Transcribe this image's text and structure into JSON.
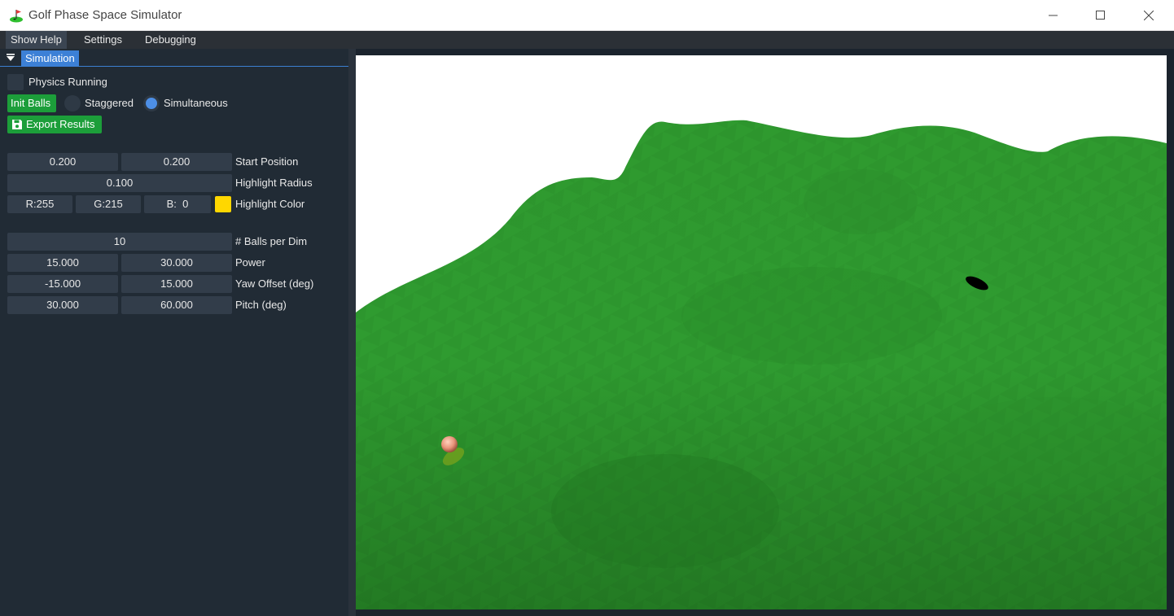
{
  "window": {
    "title": "Golf Phase Space Simulator",
    "icon": "golf-flag-icon",
    "controls": [
      "minimize-icon",
      "maximize-icon",
      "close-icon"
    ]
  },
  "menu": {
    "show_help": "Show Help",
    "settings": "Settings",
    "debugging": "Debugging"
  },
  "panel": {
    "tab": "Simulation",
    "physics_running": {
      "label": "Physics Running",
      "checked": false
    },
    "init_balls": "Init Balls",
    "mode": {
      "staggered": "Staggered",
      "simultaneous": "Simultaneous",
      "selected": "Simultaneous"
    },
    "export_results": "Export Results",
    "export_icon": "save-icon",
    "start_position": {
      "label": "Start Position",
      "x": "0.200",
      "y": "0.200"
    },
    "highlight_radius": {
      "label": "Highlight Radius",
      "value": "0.100"
    },
    "highlight_color": {
      "label": "Highlight Color",
      "r": "R:255",
      "g": "G:215",
      "b": "B:  0",
      "swatch": "#ffd700"
    },
    "balls_per_dim": {
      "label": "# Balls per Dim",
      "value": "10"
    },
    "power": {
      "label": "Power",
      "min": "15.000",
      "max": "30.000"
    },
    "yaw_offset": {
      "label": "Yaw Offset (deg)",
      "min": "-15.000",
      "max": "15.000"
    },
    "pitch": {
      "label": "Pitch (deg)",
      "min": "30.000",
      "max": "60.000"
    }
  },
  "scene": {
    "terrain_color": "#2e9a2e",
    "ball_color": "#e89a7c",
    "hole_color": "#000000",
    "background": "#ffffff"
  }
}
